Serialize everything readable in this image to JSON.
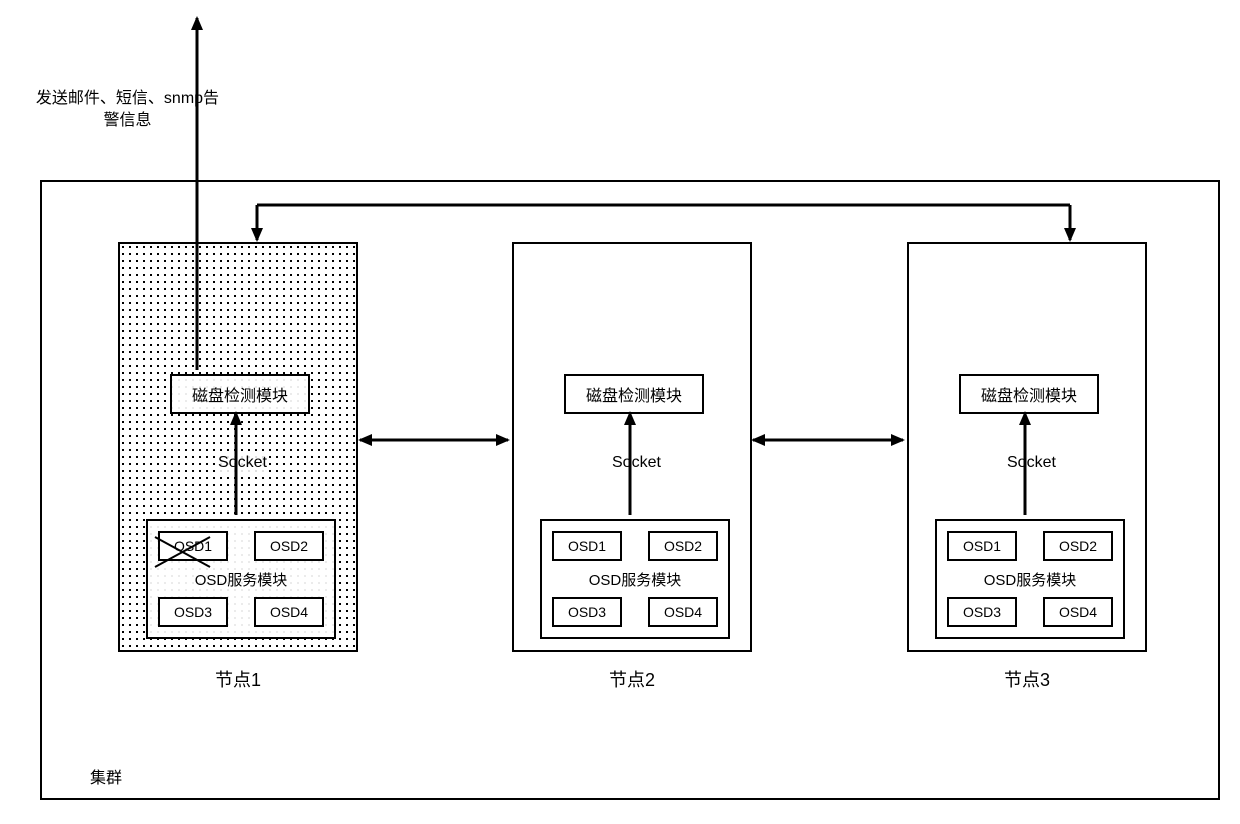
{
  "alert_text": "发送邮件、短信、snmp告警信息",
  "cluster_label": "集群",
  "socket_label": "Socket",
  "nodes": {
    "n1": {
      "label": "节点1",
      "detect_module": "磁盘检测模块",
      "osd_module_title": "OSD服务模块",
      "osd": {
        "a": "OSD1",
        "b": "OSD2",
        "c": "OSD3",
        "d": "OSD4"
      },
      "osd1_crossed": true
    },
    "n2": {
      "label": "节点2",
      "detect_module": "磁盘检测模块",
      "osd_module_title": "OSD服务模块",
      "osd": {
        "a": "OSD1",
        "b": "OSD2",
        "c": "OSD3",
        "d": "OSD4"
      }
    },
    "n3": {
      "label": "节点3",
      "detect_module": "磁盘检测模块",
      "osd_module_title": "OSD服务模块",
      "osd": {
        "a": "OSD1",
        "b": "OSD2",
        "c": "OSD3",
        "d": "OSD4"
      }
    }
  }
}
